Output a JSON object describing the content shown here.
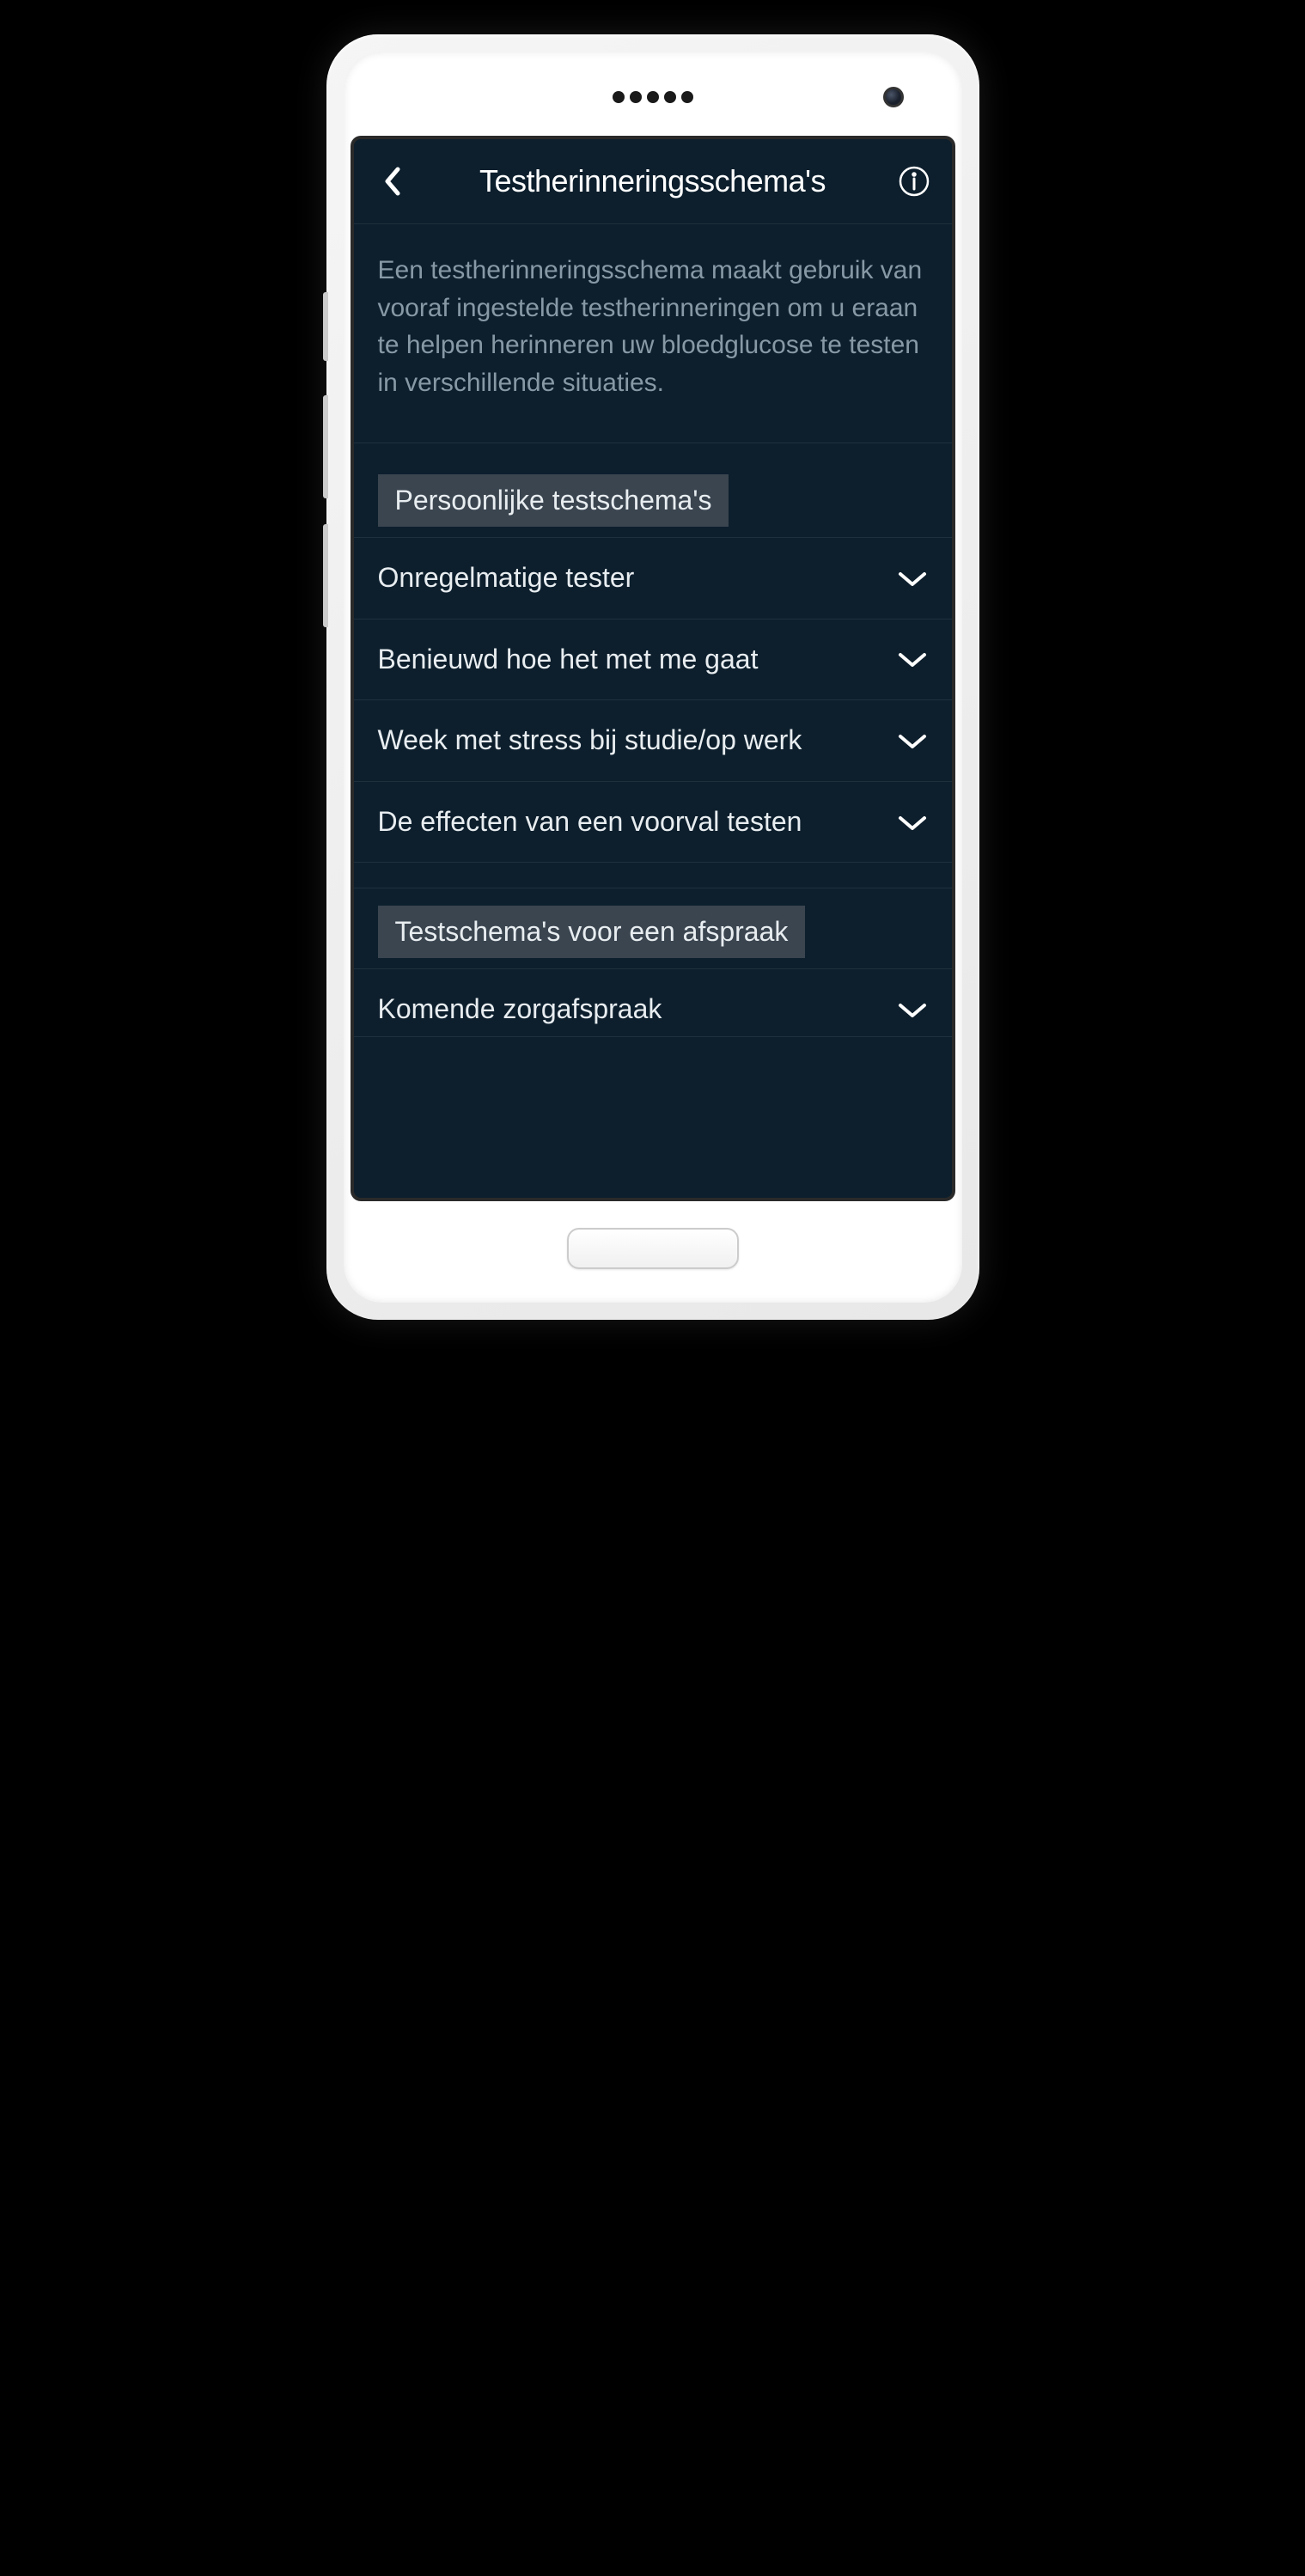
{
  "header": {
    "title": "Testherinneringsschema's"
  },
  "description": "Een testherinneringsschema maakt gebruik van vooraf ingestelde testherinneringen om u eraan te helpen herinneren uw bloedglucose te testen in verschillende situaties.",
  "sections": [
    {
      "title": "Persoonlijke testschema's",
      "items": [
        {
          "label": "Onregelmatige tester"
        },
        {
          "label": "Benieuwd hoe het met me gaat"
        },
        {
          "label": "Week met stress bij studie/op werk"
        },
        {
          "label": "De effecten van een voorval testen"
        }
      ]
    },
    {
      "title": "Testschema's voor een afspraak",
      "items": [
        {
          "label": "Komende zorgafspraak"
        }
      ]
    }
  ]
}
